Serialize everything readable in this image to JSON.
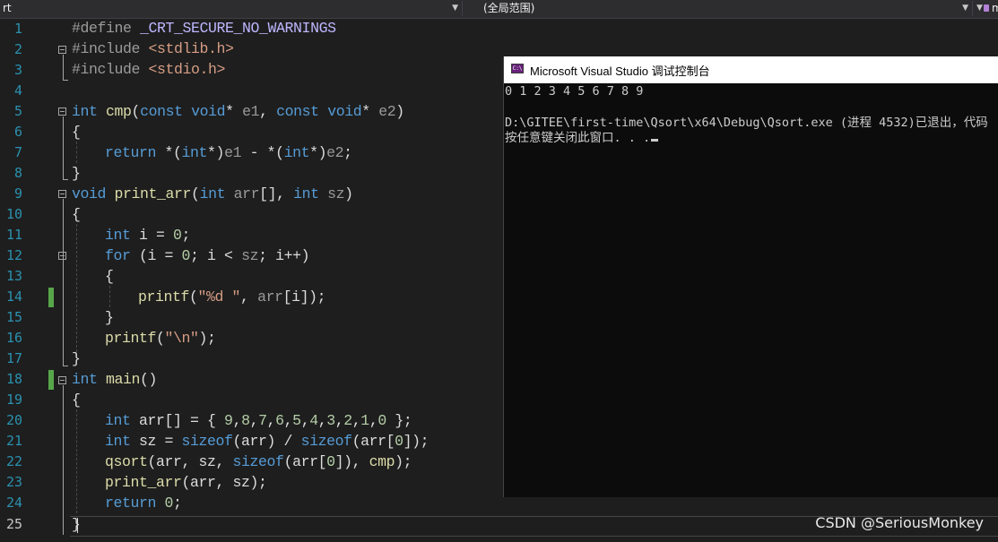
{
  "navbar": {
    "project_combo": "rt",
    "scope_combo": "(全局范围)",
    "member_combo": "m"
  },
  "editor": {
    "line_numbers": [
      "1",
      "2",
      "3",
      "4",
      "5",
      "6",
      "7",
      "8",
      "9",
      "10",
      "11",
      "12",
      "13",
      "14",
      "15",
      "16",
      "17",
      "18",
      "19",
      "20",
      "21",
      "22",
      "23",
      "24",
      "25"
    ],
    "current_line": 25
  },
  "console": {
    "title": "Microsoft Visual Studio 调试控制台",
    "icon_label": "C:\\",
    "output_line1": "0 1 2 3 4 5 6 7 8 9",
    "output_line2": "D:\\GITEE\\first-time\\Qsort\\x64\\Debug\\Qsort.exe (进程 4532)已退出，代码",
    "output_line3": "按任意键关闭此窗口. . ."
  },
  "watermark": "CSDN @SeriousMonkey",
  "colors": {
    "keyword": "#569cd6",
    "string": "#d69d85",
    "function": "#dcdcaa",
    "number": "#b5cea8",
    "macro": "#beb7ff",
    "preprocessor": "#9b9b9b",
    "change_marker": "#57a64a",
    "line_number": "#2b91af"
  }
}
